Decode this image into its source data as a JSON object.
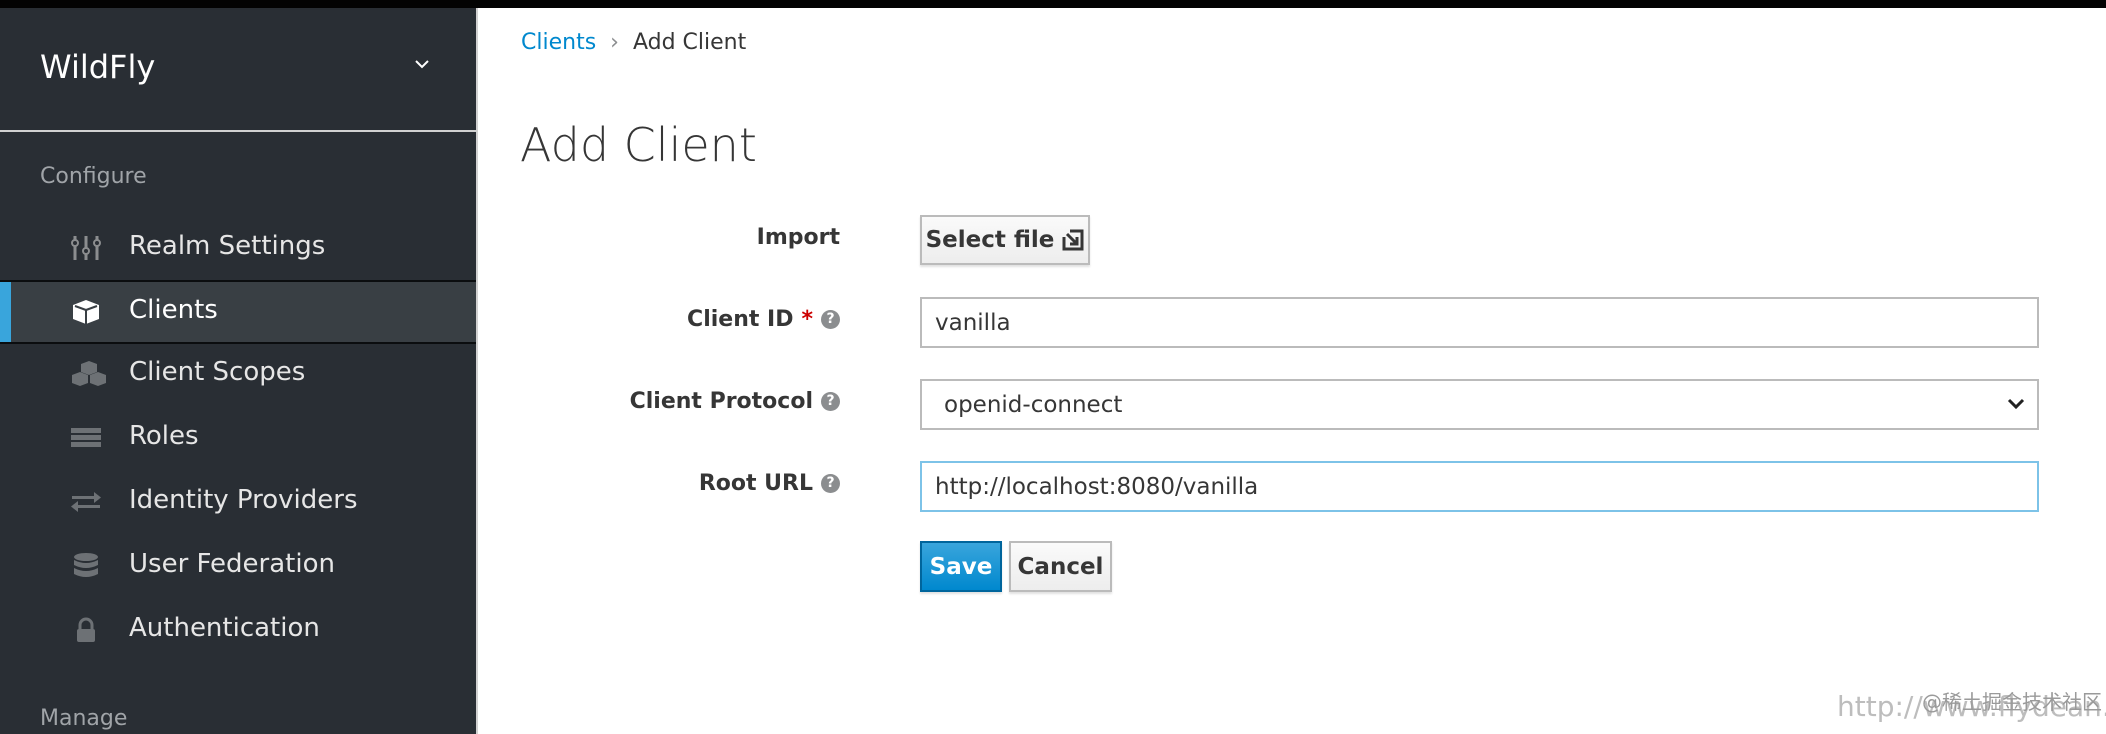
{
  "sidebar": {
    "realm": "WildFly",
    "section_configure": "Configure",
    "section_manage": "Manage",
    "items": [
      {
        "label": "Realm Settings",
        "icon": "sliders-icon"
      },
      {
        "label": "Clients",
        "icon": "cube-icon",
        "active": true
      },
      {
        "label": "Client Scopes",
        "icon": "cubes-icon"
      },
      {
        "label": "Roles",
        "icon": "list-icon"
      },
      {
        "label": "Identity Providers",
        "icon": "exchange-icon"
      },
      {
        "label": "User Federation",
        "icon": "database-icon"
      },
      {
        "label": "Authentication",
        "icon": "lock-icon"
      }
    ]
  },
  "breadcrumb": {
    "parent": "Clients",
    "current": "Add Client"
  },
  "page_title": "Add Client",
  "form": {
    "import_label": "Import",
    "select_file": "Select file",
    "client_id_label": "Client ID",
    "required_mark": "*",
    "client_id_value": "vanilla",
    "protocol_label": "Client Protocol",
    "protocol_value": "openid-connect",
    "root_url_label": "Root URL",
    "root_url_value": "http://localhost:8080/vanilla",
    "help": "?",
    "save": "Save",
    "cancel": "Cancel"
  },
  "watermark": {
    "url": "http://www.flydean.com",
    "community": "@稀土掘金技术社区"
  },
  "colors": {
    "sidebar": "#292e34",
    "accent": "#39a5dc",
    "link": "#0088ce"
  }
}
